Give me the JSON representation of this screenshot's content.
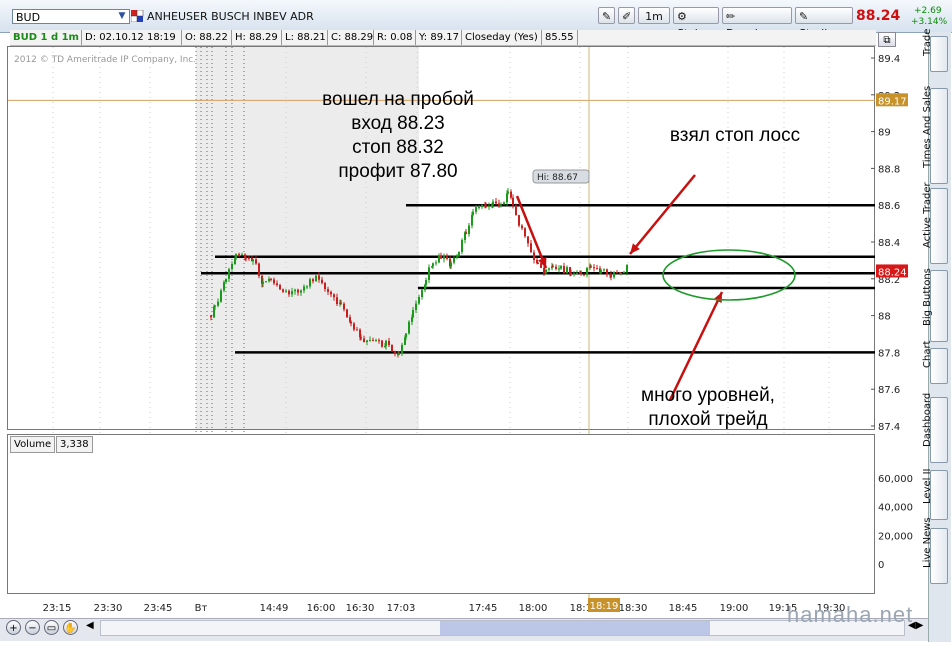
{
  "toolbar": {
    "symbol": "BUD",
    "company": "ANHEUSER BUSCH INBEV ADR",
    "aggregation": "1m",
    "style_label": "Style",
    "drawings_label": "Drawings",
    "studies_label": "Studies",
    "last_price": "88.24",
    "change_abs": "+2.69",
    "change_pct": "+3.14%"
  },
  "infobar": {
    "symbol_period": "BUD 1 d 1m",
    "date": "D: 02.10.12 18:19",
    "open": "O: 88.22",
    "high": "H: 88.29",
    "low": "L: 88.21",
    "close": "C: 88.29",
    "range": "R: 0.08",
    "y": "Y: 89.17",
    "closeday_label": "Closeday (Yes)",
    "closeday_value": "85.55"
  },
  "chart": {
    "copyright": "2012 © TD Ameritrade IP Company, Inc.",
    "price_ticks": [
      "89.4",
      "89.2",
      "89",
      "88.8",
      "88.6",
      "88.4",
      "88.2",
      "88",
      "87.8",
      "87.6",
      "87.4"
    ],
    "prev_close_flag": "89.17",
    "last_flag": "88.24",
    "hi_label": "Hi: 88.67",
    "time_ticks": [
      "23:15",
      "23:30",
      "23:45",
      "Вт",
      "14:49",
      "16:00",
      "16:30",
      "17:03",
      "17:45",
      "18:00",
      "18:15",
      "18:30",
      "18:45",
      "19:00",
      "19:15",
      "19:30"
    ],
    "cursor_time": "18:19"
  },
  "volume": {
    "label": "Volume",
    "value": "3,338",
    "ticks": [
      "60,000",
      "40,000",
      "20,000",
      "0"
    ]
  },
  "annotations": {
    "entry_lines": [
      "вошел на пробой",
      "вход 88.23",
      "стоп 88.32",
      "профит 87.80"
    ],
    "stop_taken": "взял стоп лосс",
    "levels_lines": [
      "много уровней,",
      "плохой трейд"
    ]
  },
  "sidebar": {
    "tabs": [
      "Trade",
      "Times And Sales",
      "Active Trader",
      "Big Buttons",
      "Chart",
      "Dashboard",
      "Level II",
      "Live News"
    ]
  },
  "watermark": "hamaha.net",
  "chart_data": {
    "type": "line",
    "title": "",
    "horizontal_levels": [
      88.6,
      88.32,
      88.23,
      88.15,
      87.8
    ],
    "ylim": [
      87.4,
      89.4
    ]
  },
  "colors": {
    "up": "#1a9a1a",
    "down": "#c81e1e",
    "level_line": "#000000",
    "arrow": "#c81010",
    "ellipse": "#1c9a2a",
    "prev_close_flag": "#c8922a",
    "last_flag": "#d81818"
  }
}
